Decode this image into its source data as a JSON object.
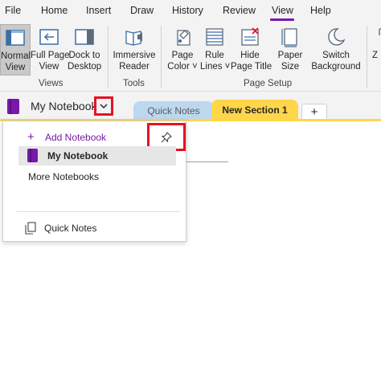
{
  "menu": {
    "tabs": [
      {
        "label": "File"
      },
      {
        "label": "Home"
      },
      {
        "label": "Insert"
      },
      {
        "label": "Draw"
      },
      {
        "label": "History"
      },
      {
        "label": "Review"
      },
      {
        "label": "View"
      },
      {
        "label": "Help"
      }
    ],
    "active_tab": "View",
    "accent_color": "#7719aa"
  },
  "ribbon": {
    "views": {
      "normal_view": {
        "line1": "Normal",
        "line2": "View"
      },
      "full_page_view": {
        "line1": "Full Page",
        "line2": "View"
      },
      "dock_to_desktop": {
        "line1": "Dock to",
        "line2": "Desktop"
      },
      "group_label": "Views"
    },
    "tools": {
      "immersive_reader": {
        "line1": "Immersive",
        "line2": "Reader"
      },
      "group_label": "Tools"
    },
    "page_setup": {
      "page_color": {
        "line1": "Page",
        "line2": "Color ˅"
      },
      "rule_lines": {
        "line1": "Rule",
        "line2": "Lines ˅"
      },
      "hide_page_title": {
        "line1": "Hide",
        "line2": "Page Title"
      },
      "paper_size": {
        "line1": "Paper",
        "line2": "Size"
      },
      "switch_background": {
        "line1": "Switch",
        "line2": "Background"
      },
      "group_label": "Page Setup"
    },
    "overflow_label": "Z"
  },
  "notebook_bar": {
    "notebook_name": "My Notebook",
    "sections": [
      {
        "label": "Quick Notes",
        "color": "#bdd7ee"
      },
      {
        "label": "New Section 1",
        "color": "#ffd54a"
      }
    ],
    "add_section_label": "+"
  },
  "notebook_panel": {
    "add_notebook_label": "Add Notebook",
    "add_icon": "+",
    "notebooks": [
      {
        "label": "My Notebook"
      }
    ],
    "more_notebooks_label": "More Notebooks",
    "quick_notes_label": "Quick Notes",
    "highlight_color": "#e81123"
  }
}
